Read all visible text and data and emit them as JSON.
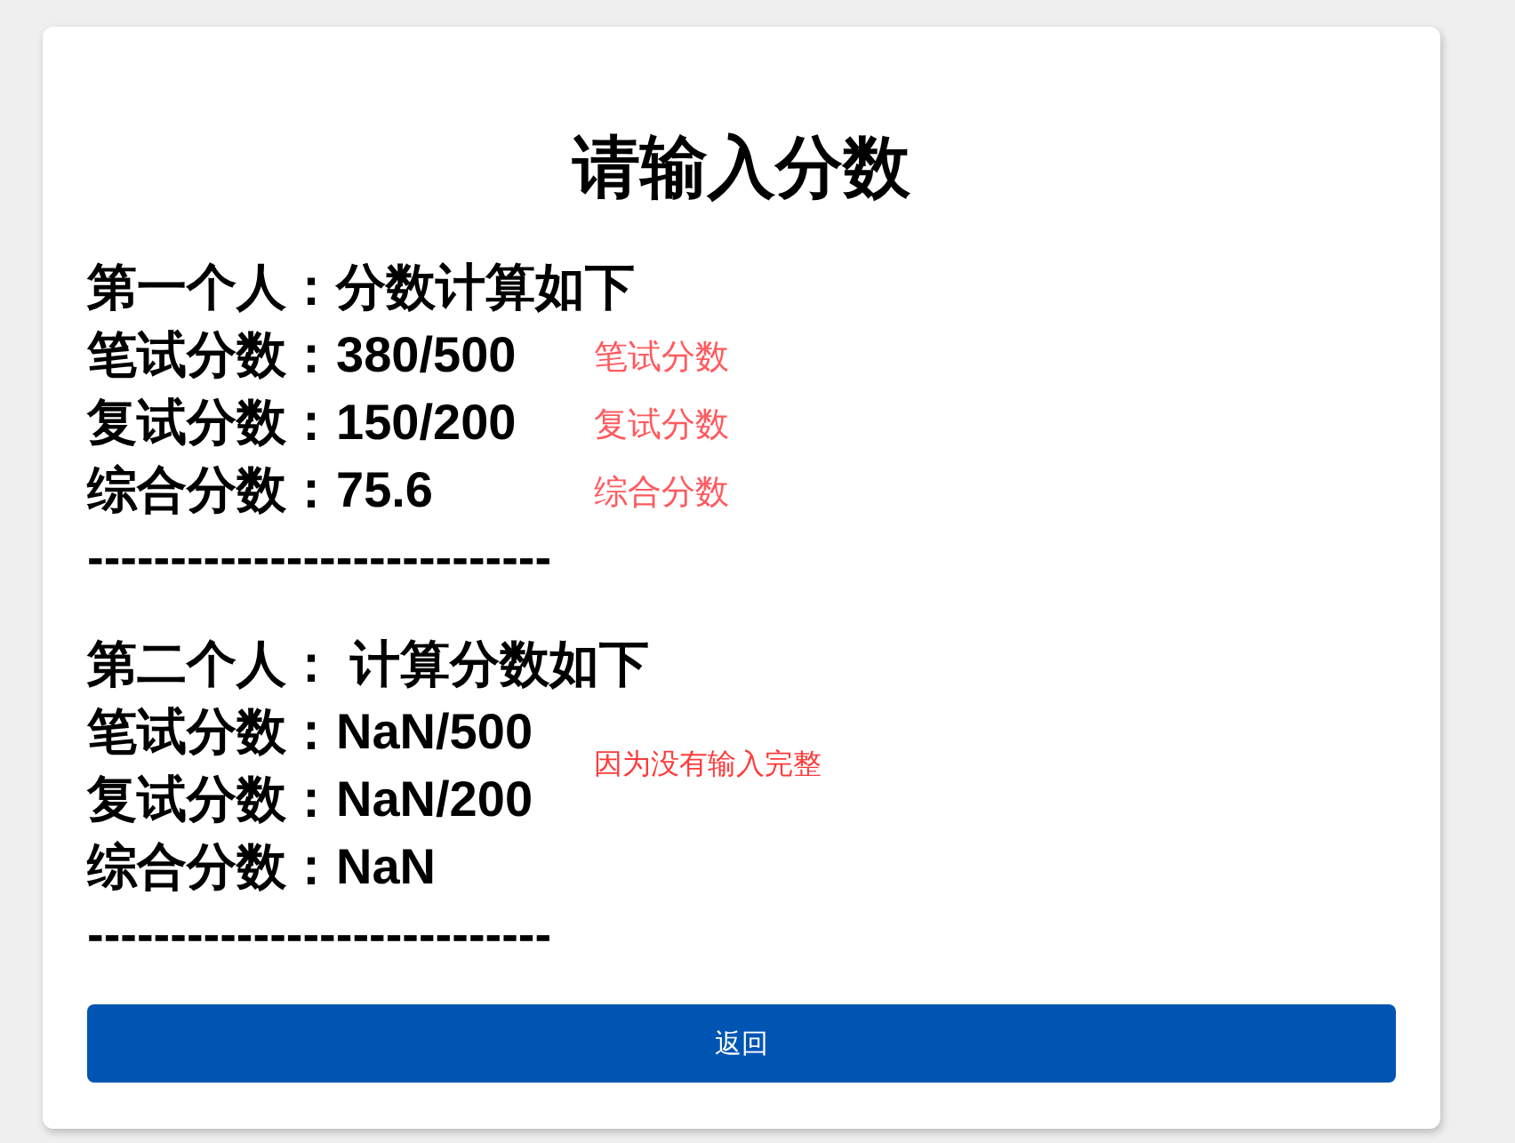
{
  "title": "请输入分数",
  "people": [
    {
      "heading": "第一个人：分数计算如下",
      "lines": [
        {
          "text": "笔试分数：380/500",
          "note": "笔试分数"
        },
        {
          "text": "复试分数：150/200",
          "note": "复试分数"
        },
        {
          "text": "综合分数：75.6",
          "note": "综合分数"
        }
      ],
      "divider": "----------------------------"
    },
    {
      "heading": "第二个人： 计算分数如下",
      "lines": [
        {
          "text": "笔试分数：NaN/500"
        },
        {
          "text": "复试分数：NaN/200"
        },
        {
          "text": "综合分数：NaN"
        }
      ],
      "note": "因为没有输入完整",
      "divider": "----------------------------"
    }
  ],
  "button": {
    "label": "返回"
  }
}
